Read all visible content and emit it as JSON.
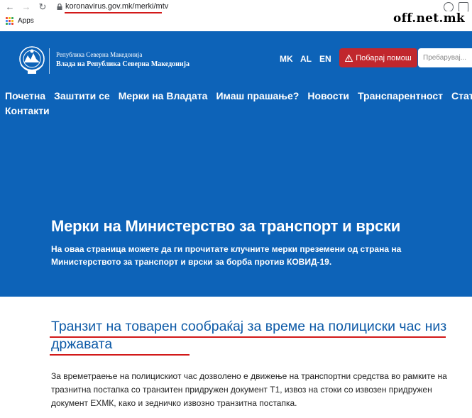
{
  "browser": {
    "url": "koronavirus.gov.mk/merki/mtv",
    "bookmarks_apps": "Apps",
    "watermark": "off.net.mk"
  },
  "header": {
    "org_line1": "Република Северна Македонија",
    "org_line2": "Влада на Република Северна Македонија",
    "languages": [
      "MK",
      "AL",
      "EN"
    ],
    "help_button": "Побарај помош",
    "search_placeholder": "Пребаруваj..."
  },
  "menu": {
    "items": [
      "Почетна",
      "Заштити се",
      "Мерки на Владата",
      "Имаш прашање?",
      "Новости",
      "Транспарентност",
      "Статистика",
      "Контакти"
    ]
  },
  "hero": {
    "title": "Мерки на Министерство за транспорт и врски",
    "description": "На оваа страница можете да ги прочитате клучните мерки преземени од страна на Министерството за транспорт и врски за борба против КОВИД-19."
  },
  "article": {
    "title": "Транзит на товарен сообраќај за време на полициски час низ државата",
    "body": "За времетраење на полицискиот час дозволено е движење на транспортни средства во рамките на тразнитна постапка со транзитен придружен документ Т1, извоз на стоки со извозен придружен документ ЕХМК, како и зедничко извозно транзитна постапка."
  },
  "colors": {
    "hero_bg": "#0d63b8",
    "help_button_bg": "#c1272d",
    "title_color": "#0d5aa7",
    "annotation_red": "#d21919"
  }
}
